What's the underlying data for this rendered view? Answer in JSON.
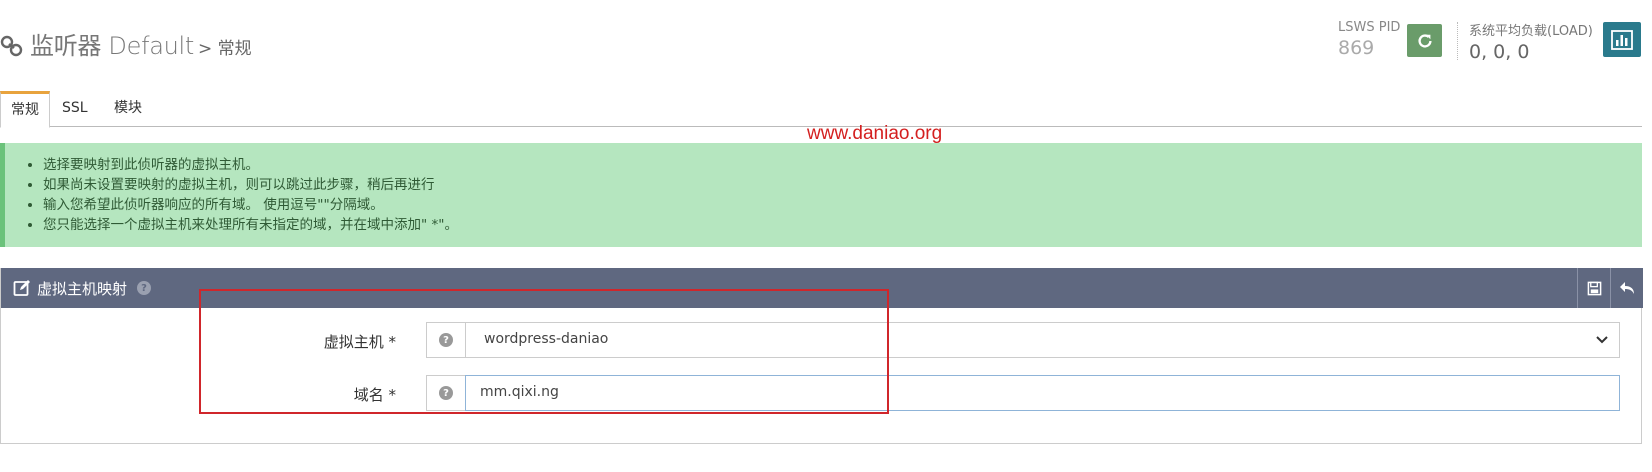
{
  "header": {
    "title_main": "监听器 Default",
    "title_sub": "> 常规",
    "pid_label": "LSWS PID",
    "pid_value": "869",
    "load_label": "系统平均负载(LOAD)",
    "load_value": "0, 0, 0"
  },
  "tabs": [
    {
      "label": "常规"
    },
    {
      "label": "SSL"
    },
    {
      "label": "模块"
    }
  ],
  "watermark": "www.daniao.org",
  "info": {
    "items": [
      "选择要映射到此侦听器的虚拟主机。",
      "如果尚未设置要映射的虚拟主机，则可以跳过此步骤，稍后再进行",
      "输入您希望此侦听器响应的所有域。 使用逗号\"\"分隔域。",
      "您只能选择一个虚拟主机来处理所有未指定的域，并在域中添加\" *\"。"
    ]
  },
  "panel": {
    "title": "虚拟主机映射",
    "vhost_label": "虚拟主机 *",
    "vhost_value": "wordpress-daniao",
    "domain_label": "域名 *",
    "domain_value": "mm.qixi.ng"
  },
  "colors": {
    "accent_tab": "#e8a33d",
    "panel_header": "#5f6880",
    "info_bg": "#b5e6bf",
    "highlight": "#d0262b"
  }
}
